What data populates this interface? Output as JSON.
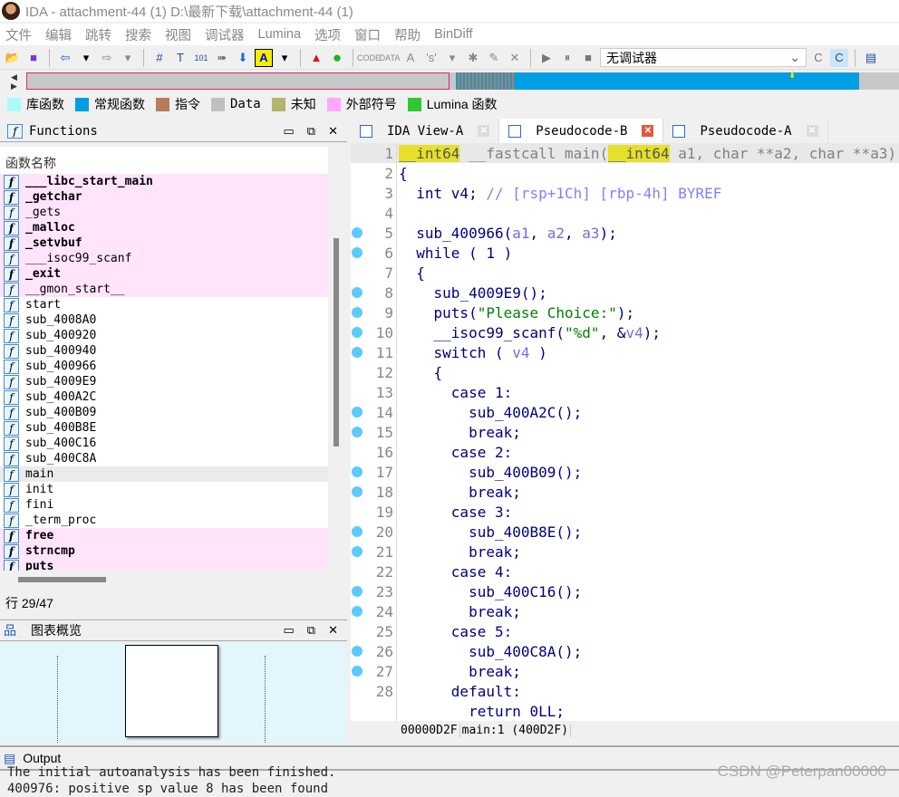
{
  "window": {
    "title": "IDA - attachment-44 (1) D:\\最新下载\\attachment-44 (1)"
  },
  "menu": [
    "文件",
    "编辑",
    "跳转",
    "搜索",
    "视图",
    "调试器",
    "Lumina",
    "选项",
    "窗口",
    "帮助",
    "BinDiff"
  ],
  "toolbar": {
    "debugger_select": "无调试器"
  },
  "legend": [
    {
      "label": "库函数",
      "color": "#a8fcfc"
    },
    {
      "label": "常规函数",
      "color": "#009fe3"
    },
    {
      "label": "指令",
      "color": "#b87c5c"
    },
    {
      "label": "Data",
      "color": "#c0c0c0"
    },
    {
      "label": "未知",
      "color": "#b4b46c"
    },
    {
      "label": "外部符号",
      "color": "#ffa8ff"
    },
    {
      "label": "Lumina 函数",
      "color": "#30c830"
    }
  ],
  "functions": {
    "title": "Functions",
    "column": "函数名称",
    "items": [
      {
        "name": "___libc_start_main",
        "imp": true,
        "bold": true
      },
      {
        "name": "_getchar",
        "imp": true,
        "bold": true
      },
      {
        "name": "_gets",
        "imp": true,
        "bold": false
      },
      {
        "name": "_malloc",
        "imp": true,
        "bold": true
      },
      {
        "name": "_setvbuf",
        "imp": true,
        "bold": true
      },
      {
        "name": "___isoc99_scanf",
        "imp": true,
        "bold": false
      },
      {
        "name": "_exit",
        "imp": true,
        "bold": true
      },
      {
        "name": "__gmon_start__",
        "imp": true,
        "bold": false
      },
      {
        "name": "start"
      },
      {
        "name": "sub_4008A0"
      },
      {
        "name": "sub_400920"
      },
      {
        "name": "sub_400940"
      },
      {
        "name": "sub_400966"
      },
      {
        "name": "sub_4009E9"
      },
      {
        "name": "sub_400A2C"
      },
      {
        "name": "sub_400B09"
      },
      {
        "name": "sub_400B8E"
      },
      {
        "name": "sub_400C16"
      },
      {
        "name": "sub_400C8A"
      },
      {
        "name": "main",
        "selected": true
      },
      {
        "name": "init"
      },
      {
        "name": "fini"
      },
      {
        "name": "_term_proc"
      },
      {
        "name": "free",
        "imp": true,
        "bold": true
      },
      {
        "name": "strncmp",
        "imp": true,
        "bold": true
      },
      {
        "name": "puts",
        "imp": true,
        "bold": true
      }
    ],
    "row_status": "行 29/47"
  },
  "overview": {
    "title": "图表概览"
  },
  "tabs": [
    {
      "label": "IDA View-A",
      "active": false
    },
    {
      "label": "Pseudocode-B",
      "active": true
    },
    {
      "label": "Pseudocode-A",
      "active": false
    }
  ],
  "code": [
    {
      "n": "1",
      "bp": false,
      "segs": [
        [
          "__int64",
          "hl"
        ],
        [
          " __fastcall main(",
          "gray"
        ],
        [
          "__int64",
          "hl"
        ],
        [
          " a1, char **a2, char **a3)",
          "gray"
        ]
      ]
    },
    {
      "n": "2",
      "bp": false,
      "segs": [
        [
          "{",
          ""
        ]
      ]
    },
    {
      "n": "3",
      "bp": false,
      "segs": [
        [
          "  int v4; ",
          ""
        ],
        [
          "// [rsp+1Ch] [rbp-4h] BYREF",
          "cmt"
        ]
      ]
    },
    {
      "n": "4",
      "bp": false,
      "segs": []
    },
    {
      "n": "5",
      "bp": true,
      "segs": [
        [
          "  sub_400966(",
          ""
        ],
        [
          "a1",
          "var"
        ],
        [
          ", ",
          ""
        ],
        [
          "a2",
          "var"
        ],
        [
          ", ",
          ""
        ],
        [
          "a3",
          "var"
        ],
        [
          ");",
          ""
        ]
      ]
    },
    {
      "n": "6",
      "bp": true,
      "segs": [
        [
          "  while ( 1 )",
          ""
        ]
      ]
    },
    {
      "n": "7",
      "bp": false,
      "segs": [
        [
          "  {",
          ""
        ]
      ]
    },
    {
      "n": "8",
      "bp": true,
      "segs": [
        [
          "    sub_4009E9();",
          ""
        ]
      ]
    },
    {
      "n": "9",
      "bp": true,
      "segs": [
        [
          "    puts(",
          ""
        ],
        [
          "\"Please Choice:\"",
          "str"
        ],
        [
          ");",
          ""
        ]
      ]
    },
    {
      "n": "10",
      "bp": true,
      "segs": [
        [
          "    __isoc99_scanf(",
          ""
        ],
        [
          "\"%d\"",
          "str"
        ],
        [
          ", &",
          ""
        ],
        [
          "v4",
          "var"
        ],
        [
          ");",
          ""
        ]
      ]
    },
    {
      "n": "11",
      "bp": true,
      "segs": [
        [
          "    switch ( ",
          ""
        ],
        [
          "v4",
          "var"
        ],
        [
          " )",
          ""
        ]
      ]
    },
    {
      "n": "12",
      "bp": false,
      "segs": [
        [
          "    {",
          ""
        ]
      ]
    },
    {
      "n": "13",
      "bp": false,
      "segs": [
        [
          "      case 1:",
          ""
        ]
      ]
    },
    {
      "n": "14",
      "bp": true,
      "segs": [
        [
          "        sub_400A2C();",
          ""
        ]
      ]
    },
    {
      "n": "15",
      "bp": true,
      "segs": [
        [
          "        break;",
          ""
        ]
      ]
    },
    {
      "n": "16",
      "bp": false,
      "segs": [
        [
          "      case 2:",
          ""
        ]
      ]
    },
    {
      "n": "17",
      "bp": true,
      "segs": [
        [
          "        sub_400B09();",
          ""
        ]
      ]
    },
    {
      "n": "18",
      "bp": true,
      "segs": [
        [
          "        break;",
          ""
        ]
      ]
    },
    {
      "n": "19",
      "bp": false,
      "segs": [
        [
          "      case 3:",
          ""
        ]
      ]
    },
    {
      "n": "20",
      "bp": true,
      "segs": [
        [
          "        sub_400B8E();",
          ""
        ]
      ]
    },
    {
      "n": "21",
      "bp": true,
      "segs": [
        [
          "        break;",
          ""
        ]
      ]
    },
    {
      "n": "22",
      "bp": false,
      "segs": [
        [
          "      case 4:",
          ""
        ]
      ]
    },
    {
      "n": "23",
      "bp": true,
      "segs": [
        [
          "        sub_400C16();",
          ""
        ]
      ]
    },
    {
      "n": "24",
      "bp": true,
      "segs": [
        [
          "        break;",
          ""
        ]
      ]
    },
    {
      "n": "25",
      "bp": false,
      "segs": [
        [
          "      case 5:",
          ""
        ]
      ]
    },
    {
      "n": "26",
      "bp": true,
      "segs": [
        [
          "        sub_400C8A();",
          ""
        ]
      ]
    },
    {
      "n": "27",
      "bp": true,
      "segs": [
        [
          "        break;",
          ""
        ]
      ]
    },
    {
      "n": "28",
      "bp": false,
      "segs": [
        [
          "      default:",
          ""
        ]
      ]
    },
    {
      "n": "",
      "bp": false,
      "segs": [
        [
          "        return 0LL;",
          ""
        ]
      ]
    }
  ],
  "code_status": {
    "offset": "00000D2F",
    "location": "main:1 (400D2F)"
  },
  "output": {
    "title": "Output",
    "lines": [
      "The initial autoanalysis has been finished.",
      "400976: positive sp value 8 has been found"
    ]
  },
  "watermark": "CSDN @Peterpan00000"
}
